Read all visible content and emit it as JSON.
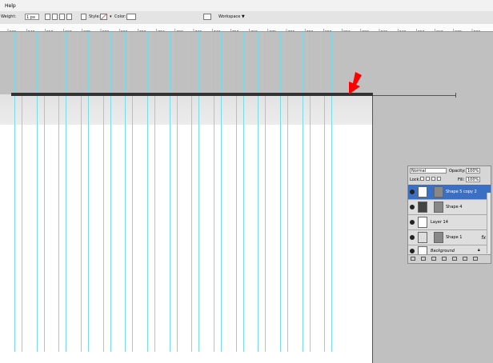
{
  "menubar": {
    "items": [
      "Help"
    ]
  },
  "options": {
    "weight_label": "Weight:",
    "weight_value": "1 px",
    "style_label": "Style:",
    "color_label": "Color:",
    "workspace_label": "Workspace ▼"
  },
  "ruler": {
    "labels": [
      "230",
      "240",
      "250",
      "260",
      "270",
      "280",
      "290",
      "700",
      "710",
      "720",
      "730",
      "740",
      "750",
      "760",
      "770",
      "780",
      "790",
      "800",
      "810",
      "820",
      "830",
      "840",
      "850",
      "860",
      "870",
      "880"
    ]
  },
  "layers_panel": {
    "blend_mode": "Normal",
    "opacity_label": "Opacity:",
    "opacity_value": "100%",
    "lock_label": "Lock:",
    "fill_label": "Fill:",
    "fill_value": "100%",
    "layers": [
      {
        "name": "Shape 5 copy 2",
        "selected": true
      },
      {
        "name": "Shape 4",
        "selected": false
      },
      {
        "name": "Layer 14",
        "selected": false
      },
      {
        "name": "Shape 1",
        "selected": false,
        "fx": "fx"
      },
      {
        "name": "Background",
        "selected": false
      }
    ]
  },
  "colors": {
    "guide": "#7ad9e6",
    "arrow": "#ff0000",
    "selected_layer": "#3a6fc4"
  }
}
